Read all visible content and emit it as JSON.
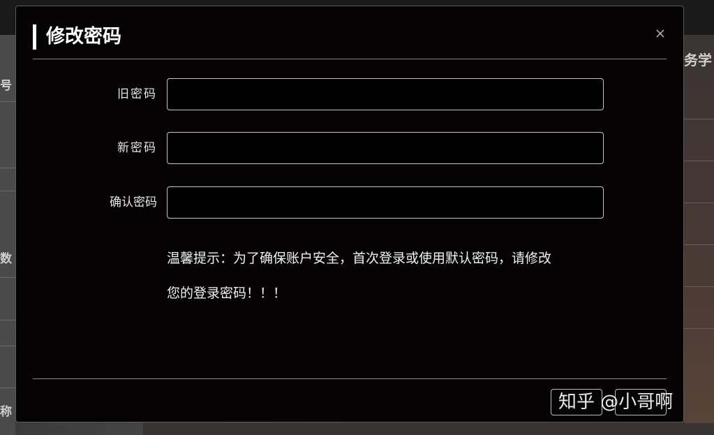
{
  "background": {
    "left_texts": [
      "号",
      "数",
      "称"
    ],
    "right_text": "务学"
  },
  "modal": {
    "title": "修改密码",
    "fields": [
      {
        "label": "旧密码",
        "value": "",
        "type": "password"
      },
      {
        "label": "新密码",
        "value": "",
        "type": "password"
      },
      {
        "label": "确认密码",
        "value": "",
        "type": "password"
      }
    ],
    "notice_line1": "温馨提示：为了确保账户安全，首次登录或使用默认密码，请修改",
    "notice_line2": "您的登录密码！！！",
    "cancel_label": "",
    "ok_label": ""
  },
  "watermark": "知乎 @小哥啊",
  "colors": {
    "modal_bg": "#040203",
    "text": "#ffffff",
    "input_border": "#c8c8c8"
  }
}
